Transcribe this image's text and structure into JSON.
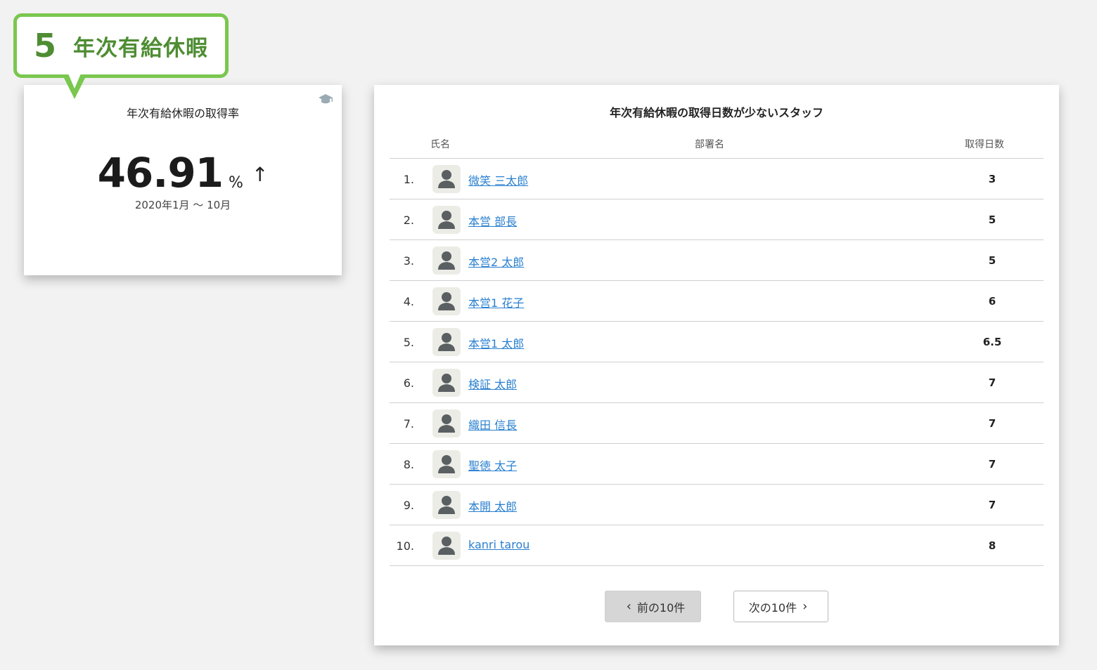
{
  "callout": {
    "number": "5",
    "title": "年次有給休暇"
  },
  "rate_card": {
    "title": "年次有給休暇の取得率",
    "icon": "graduation-cap-icon",
    "value": "46.91",
    "unit": "%",
    "trend": "↑",
    "period": "2020年1月 〜 10月"
  },
  "staff_card": {
    "title": "年次有給休暇の取得日数が少ないスタッフ",
    "columns": {
      "name": "氏名",
      "dept": "部署名",
      "days": "取得日数"
    },
    "rows": [
      {
        "rank": "1.",
        "name": "微笑 三太郎",
        "dept": "",
        "days": "3"
      },
      {
        "rank": "2.",
        "name": "本営 部長",
        "dept": "",
        "days": "5"
      },
      {
        "rank": "3.",
        "name": "本営2 太郎",
        "dept": "",
        "days": "5"
      },
      {
        "rank": "4.",
        "name": "本営1 花子",
        "dept": "",
        "days": "6"
      },
      {
        "rank": "5.",
        "name": "本営1 太郎",
        "dept": "",
        "days": "6.5"
      },
      {
        "rank": "6.",
        "name": "検証 太郎",
        "dept": "",
        "days": "7"
      },
      {
        "rank": "7.",
        "name": "織田 信長",
        "dept": "",
        "days": "7"
      },
      {
        "rank": "8.",
        "name": "聖徳 太子",
        "dept": "",
        "days": "7"
      },
      {
        "rank": "9.",
        "name": "本開 太郎",
        "dept": "",
        "days": "7"
      },
      {
        "rank": "10.",
        "name": "kanri tarou",
        "dept": "",
        "days": "8"
      }
    ],
    "pager": {
      "prev_label": "前の10件",
      "next_label": "次の10件"
    }
  },
  "colors": {
    "accent_green": "#7ac74f",
    "title_green": "#4e8d33",
    "link_blue": "#2a80d0",
    "background": "#f2f2f2"
  }
}
